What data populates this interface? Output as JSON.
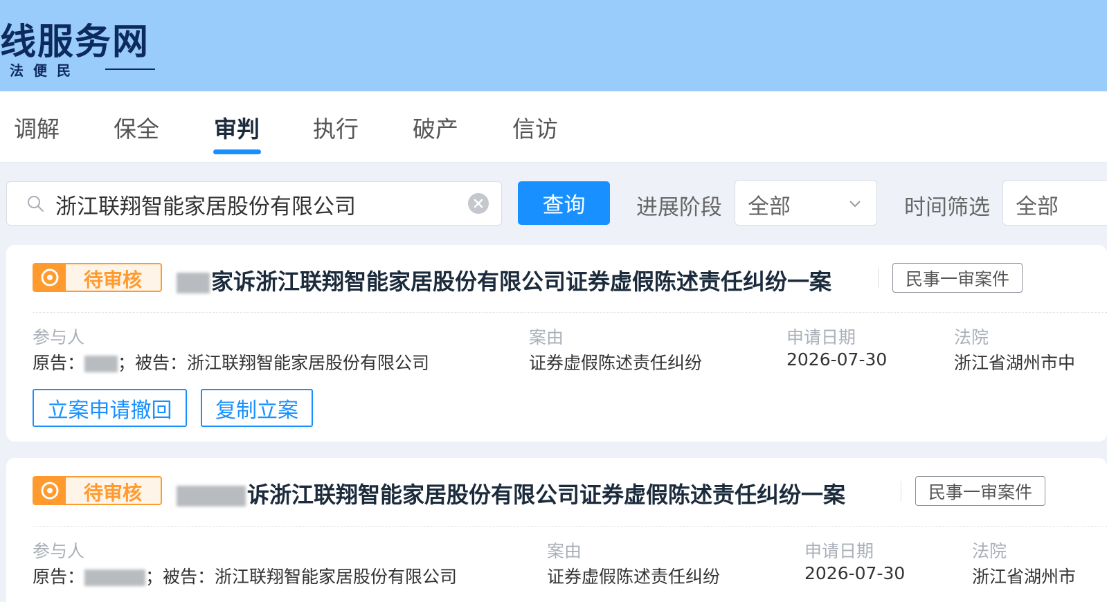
{
  "header": {
    "logo_title": "线服务网",
    "logo_subtitle": "司法便民"
  },
  "tabs": [
    {
      "label": "调解",
      "active": false
    },
    {
      "label": "保全",
      "active": false
    },
    {
      "label": "审判",
      "active": true
    },
    {
      "label": "执行",
      "active": false
    },
    {
      "label": "破产",
      "active": false
    },
    {
      "label": "信访",
      "active": false
    }
  ],
  "search": {
    "value": "浙江联翔智能家居股份有限公司",
    "query_label": "查询"
  },
  "filters": {
    "stage_label": "进展阶段",
    "stage_value": "全部",
    "time_label": "时间筛选",
    "time_value": "全部"
  },
  "cases": [
    {
      "status": "待审核",
      "title": "诉浙江联翔智能家居股份有限公司证券虚假陈述责任纠纷一案",
      "title_prefix_visible": "家",
      "type": "民事一审案件",
      "participants_label": "参与人",
      "participants": "原告：；被告：浙江联翔智能家居股份有限公司",
      "plaintiff_prefix": "原告：",
      "defendant_text": "；被告：浙江联翔智能家居股份有限公司",
      "cause_label": "案由",
      "cause": "证券虚假陈述责任纠纷",
      "date_label": "申请日期",
      "date": "2026-07-30",
      "court_label": "法院",
      "court": "浙江省湖州市中",
      "actions": [
        "立案申请撤回",
        "复制立案"
      ]
    },
    {
      "status": "待审核",
      "title": "诉浙江联翔智能家居股份有限公司证券虚假陈述责任纠纷一案",
      "type": "民事一审案件",
      "participants_label": "参与人",
      "plaintiff_prefix": "原告：",
      "defendant_text": "；被告：浙江联翔智能家居股份有限公司",
      "cause_label": "案由",
      "cause": "证券虚假陈述责任纠纷",
      "date_label": "申请日期",
      "date": "2026-07-30",
      "court_label": "法院",
      "court": "浙江省湖州市"
    }
  ],
  "colors": {
    "header_bg": "#99ccfb",
    "accent": "#1890ff",
    "status_orange": "#ff9a2e"
  }
}
